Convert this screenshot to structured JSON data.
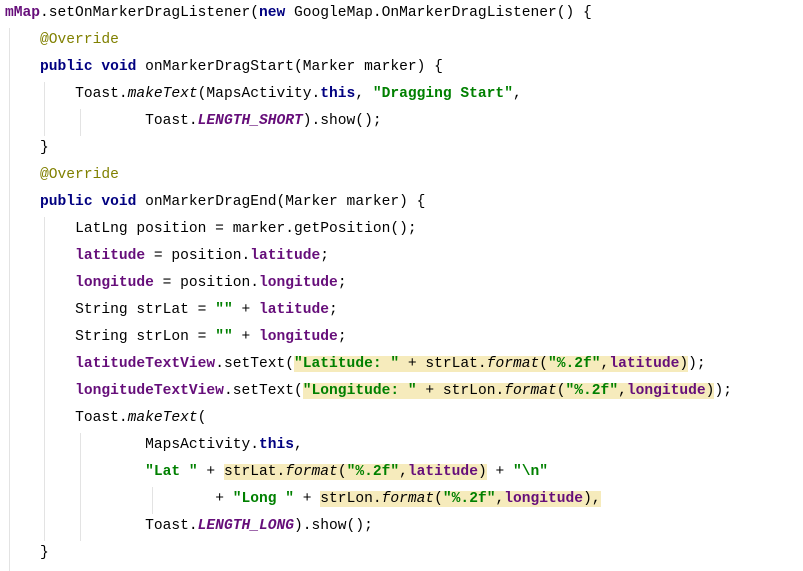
{
  "code": {
    "indent_unit": 4,
    "lines": [
      {
        "i": 0,
        "tok": [
          {
            "t": "mMap",
            "c": "fld"
          },
          {
            "t": ".setOnMarkerDragListener("
          },
          {
            "t": "new",
            "c": "kw"
          },
          {
            "t": " GoogleMap.OnMarkerDragListener() {"
          }
        ]
      },
      {
        "i": 4,
        "tok": [
          {
            "t": "@Override",
            "c": "ann"
          }
        ]
      },
      {
        "i": 4,
        "tok": [
          {
            "t": "public void",
            "c": "kw"
          },
          {
            "t": " onMarkerDragStart(Marker marker) {"
          }
        ]
      },
      {
        "i": 8,
        "tok": [
          {
            "t": "Toast."
          },
          {
            "t": "makeText",
            "c": "it"
          },
          {
            "t": "(MapsActivity."
          },
          {
            "t": "this",
            "c": "kw"
          },
          {
            "t": ", "
          },
          {
            "t": "\"Dragging Start\"",
            "c": "str"
          },
          {
            "t": ","
          }
        ]
      },
      {
        "i": 16,
        "tok": [
          {
            "t": "Toast."
          },
          {
            "t": "LENGTH_SHORT",
            "c": "st"
          },
          {
            "t": ").show();"
          }
        ]
      },
      {
        "i": 4,
        "tok": [
          {
            "t": "}"
          }
        ]
      },
      {
        "i": 4,
        "tok": [
          {
            "t": "@Override",
            "c": "ann"
          }
        ]
      },
      {
        "i": 4,
        "tok": [
          {
            "t": "public void",
            "c": "kw"
          },
          {
            "t": " onMarkerDragEnd(Marker marker) {"
          }
        ]
      },
      {
        "i": 8,
        "tok": [
          {
            "t": "LatLng position = marker.getPosition();"
          }
        ]
      },
      {
        "i": 8,
        "tok": [
          {
            "t": "latitude",
            "c": "fld"
          },
          {
            "t": " = position."
          },
          {
            "t": "latitude",
            "c": "fld"
          },
          {
            "t": ";"
          }
        ]
      },
      {
        "i": 8,
        "tok": [
          {
            "t": "longitude",
            "c": "fld"
          },
          {
            "t": " = position."
          },
          {
            "t": "longitude",
            "c": "fld"
          },
          {
            "t": ";"
          }
        ]
      },
      {
        "i": 8,
        "tok": [
          {
            "t": "String strLat = "
          },
          {
            "t": "\"\"",
            "c": "str"
          },
          {
            "t": " + "
          },
          {
            "t": "latitude",
            "c": "fld"
          },
          {
            "t": ";"
          }
        ]
      },
      {
        "i": 8,
        "tok": [
          {
            "t": "String strLon = "
          },
          {
            "t": "\"\"",
            "c": "str"
          },
          {
            "t": " + "
          },
          {
            "t": "longitude",
            "c": "fld"
          },
          {
            "t": ";"
          }
        ]
      },
      {
        "i": 8,
        "tok": [
          {
            "t": "latitudeTextView",
            "c": "fld"
          },
          {
            "t": ".setText("
          },
          {
            "t": "\"Latitude: \"",
            "c": "str hl"
          },
          {
            "t": " + strLat.",
            "c": "hl"
          },
          {
            "t": "format",
            "c": "it hl"
          },
          {
            "t": "(",
            "c": "hl"
          },
          {
            "t": "\"%.2f\"",
            "c": "str hl"
          },
          {
            "t": ",",
            "c": "hl"
          },
          {
            "t": "latitude",
            "c": "fld hl"
          },
          {
            "t": ")",
            "c": "hl"
          },
          {
            "t": ");"
          }
        ]
      },
      {
        "i": 8,
        "tok": [
          {
            "t": "longitudeTextView",
            "c": "fld"
          },
          {
            "t": ".setText("
          },
          {
            "t": "\"Longitude: \"",
            "c": "str hl"
          },
          {
            "t": " + strLon.",
            "c": "hl"
          },
          {
            "t": "format",
            "c": "it hl"
          },
          {
            "t": "(",
            "c": "hl"
          },
          {
            "t": "\"%.2f\"",
            "c": "str hl"
          },
          {
            "t": ",",
            "c": "hl"
          },
          {
            "t": "longitude",
            "c": "fld hl"
          },
          {
            "t": ")",
            "c": "hl"
          },
          {
            "t": ");"
          }
        ]
      },
      {
        "i": 8,
        "tok": [
          {
            "t": "Toast."
          },
          {
            "t": "makeText",
            "c": "it"
          },
          {
            "t": "("
          }
        ]
      },
      {
        "i": 16,
        "tok": [
          {
            "t": "MapsActivity."
          },
          {
            "t": "this",
            "c": "kw"
          },
          {
            "t": ","
          }
        ]
      },
      {
        "i": 16,
        "tok": [
          {
            "t": "\"Lat \"",
            "c": "str"
          },
          {
            "t": " + "
          },
          {
            "t": "strLat.",
            "c": "hl"
          },
          {
            "t": "format",
            "c": "it hl"
          },
          {
            "t": "(",
            "c": "hl"
          },
          {
            "t": "\"%.2f\"",
            "c": "str hl"
          },
          {
            "t": ",",
            "c": "hl"
          },
          {
            "t": "latitude",
            "c": "fld hl"
          },
          {
            "t": ")",
            "c": "hl"
          },
          {
            "t": " + "
          },
          {
            "t": "\"\\n\"",
            "c": "str"
          }
        ]
      },
      {
        "i": 24,
        "tok": [
          {
            "t": "+ "
          },
          {
            "t": "\"Long \"",
            "c": "str"
          },
          {
            "t": " + "
          },
          {
            "t": "strLon.",
            "c": "hl"
          },
          {
            "t": "format",
            "c": "it hl"
          },
          {
            "t": "(",
            "c": "hl"
          },
          {
            "t": "\"%.2f\"",
            "c": "str hl"
          },
          {
            "t": ",",
            "c": "hl"
          },
          {
            "t": "longitude",
            "c": "fld hl"
          },
          {
            "t": "),",
            "c": "hl"
          }
        ]
      },
      {
        "i": 16,
        "tok": [
          {
            "t": "Toast."
          },
          {
            "t": "LENGTH_LONG",
            "c": "st"
          },
          {
            "t": ").show();"
          }
        ]
      },
      {
        "i": 4,
        "tok": [
          {
            "t": "}"
          }
        ]
      }
    ]
  }
}
